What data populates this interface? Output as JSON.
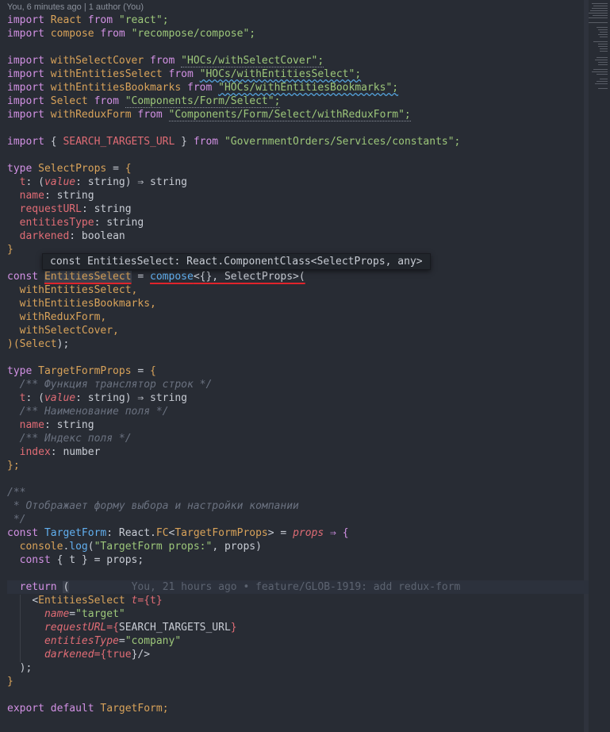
{
  "blame_header": "You, 6 minutes ago | 1 author (You)",
  "tooltip": "const EntitiesSelect: React.ComponentClass<SelectProps, any>",
  "inline_blame": "You, 21 hours ago • feature/GLOB-1919: add redux-form",
  "code": {
    "l1": [
      "import",
      "React",
      "from",
      "\"react\";"
    ],
    "l2": [
      "import",
      "compose",
      "from",
      "\"recompose/compose\";"
    ],
    "l4": [
      "import",
      "withSelectCover",
      "from",
      "\"HOCs/withSelectCover\";"
    ],
    "l5": [
      "import",
      "withEntitiesSelect",
      "from",
      "\"HOCs/withEntitiesSelect\";"
    ],
    "l6": [
      "import",
      "withEntitiesBookmarks",
      "from",
      "\"HOCs/withEntitiesBookmarks\";"
    ],
    "l7": [
      "import",
      "Select",
      "from",
      "\"Components/Form/Select\";"
    ],
    "l8": [
      "import",
      "withReduxForm",
      "from",
      "\"Components/Form/Select/withReduxForm\";"
    ],
    "l10": [
      "import",
      "{",
      "SEARCH_TARGETS_URL",
      "}",
      "from",
      "\"GovernmentOrders/Services/constants\";"
    ],
    "l12": [
      "type",
      "SelectProps",
      "=",
      "{"
    ],
    "l13": [
      "t",
      ": (",
      "value",
      ": string) ⇒ string"
    ],
    "l14": [
      "name",
      ": string"
    ],
    "l15": [
      "requestURL",
      ": string"
    ],
    "l16": [
      "entitiesType",
      ": string"
    ],
    "l17": [
      "darkened",
      ": boolean"
    ],
    "l18": [
      "}"
    ],
    "l20": [
      "const",
      "EntitiesSelect",
      "=",
      "compose",
      "<{}, SelectProps>("
    ],
    "l21": [
      "withEntitiesSelect,"
    ],
    "l22": [
      "withEntitiesBookmarks,"
    ],
    "l23": [
      "withReduxForm,"
    ],
    "l24": [
      "withSelectCover,"
    ],
    "l25": [
      ")(",
      "Select",
      ");"
    ],
    "l27": [
      "type",
      "TargetFormProps",
      "=",
      "{"
    ],
    "l28": [
      "/** Функция транслятор строк */"
    ],
    "l29": [
      "t",
      ": (",
      "value",
      ": string) ⇒ string"
    ],
    "l30": [
      "/** Наименование поля */"
    ],
    "l31": [
      "name",
      ": string"
    ],
    "l32": [
      "/** Индекс поля */"
    ],
    "l33": [
      "index",
      ": number"
    ],
    "l34": [
      "};"
    ],
    "l36": [
      "/**"
    ],
    "l37": [
      " * Отображает форму выбора и настройки компании"
    ],
    "l38": [
      " */"
    ],
    "l39": [
      "const",
      "TargetForm",
      ": React.",
      "FC",
      "<",
      "TargetFormProps",
      "> =",
      "props",
      "⇒ {"
    ],
    "l40": [
      "console",
      ".",
      "log",
      "(",
      "\"TargetForm props:\"",
      ", props)"
    ],
    "l41": [
      "const",
      "{ t } = props;"
    ],
    "l43": [
      "return",
      "("
    ],
    "l44": [
      "<",
      "EntitiesSelect",
      "t",
      "={",
      "t",
      "}"
    ],
    "l45": [
      "name",
      "=",
      "\"target\""
    ],
    "l46": [
      "requestURL",
      "={",
      "SEARCH_TARGETS_URL",
      "}"
    ],
    "l47": [
      "entitiesType",
      "=",
      "\"company\""
    ],
    "l48": [
      "darkened",
      "={",
      "true",
      "}/>"
    ],
    "l49": [
      ");"
    ],
    "l50": [
      "}"
    ],
    "l52": [
      "export",
      "default",
      "TargetForm;"
    ]
  }
}
